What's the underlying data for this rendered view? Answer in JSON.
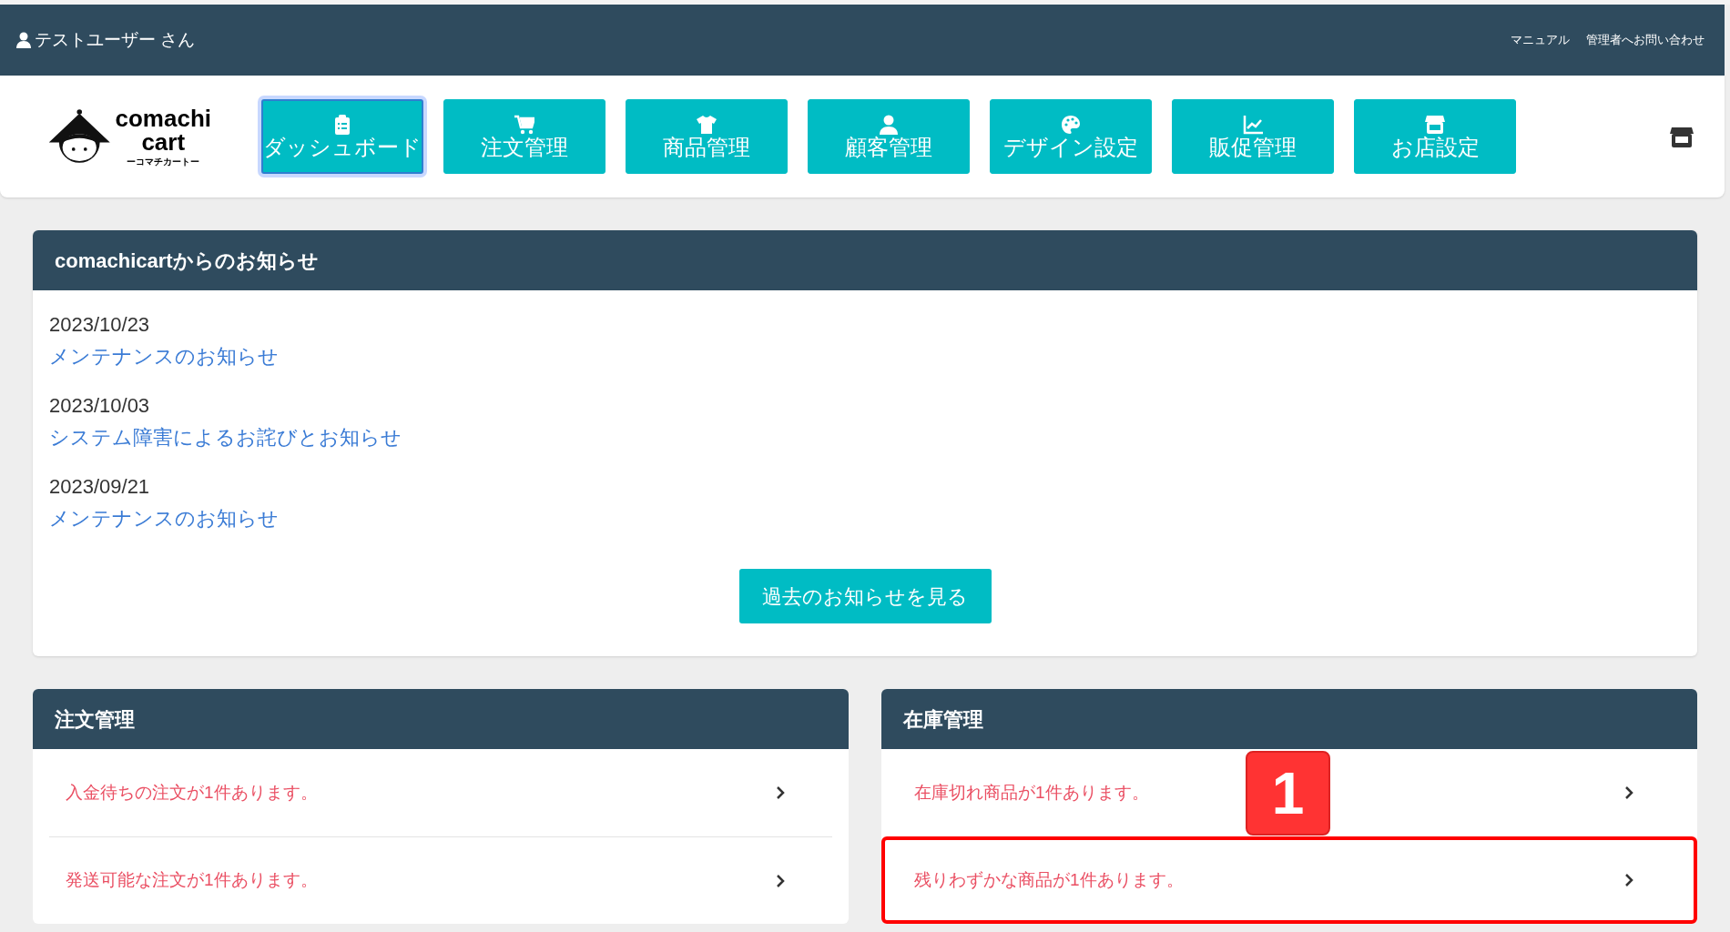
{
  "top_bar": {
    "user": "テストユーザー さん",
    "links": [
      "マニュアル",
      "管理者へお問い合わせ"
    ]
  },
  "logo": {
    "name_line_1": "comachi",
    "name_line_2": "cart",
    "reading": "ーコマチカートー"
  },
  "nav": [
    {
      "label": "ダッシュボード",
      "selected": true
    },
    {
      "label": "注文管理",
      "selected": false
    },
    {
      "label": "商品管理",
      "selected": false
    },
    {
      "label": "顧客管理",
      "selected": false
    },
    {
      "label": "デザイン設定",
      "selected": false
    },
    {
      "label": "販促管理",
      "selected": false
    },
    {
      "label": "お店設定",
      "selected": false
    }
  ],
  "notices": {
    "title": "comachicartからのお知らせ",
    "items": [
      {
        "date": "2023/10/23",
        "title": "メンテナンスのお知らせ"
      },
      {
        "date": "2023/10/03",
        "title": "システム障害によるお詫びとお知らせ"
      },
      {
        "date": "2023/09/21",
        "title": "メンテナンスのお知らせ"
      }
    ],
    "more_button": "過去のお知らせを見る"
  },
  "panels": [
    {
      "title": "注文管理",
      "items": [
        {
          "text": "入金待ちの注文が1件あります。",
          "highlighted": false
        },
        {
          "text": "発送可能な注文が1件あります。",
          "highlighted": false
        }
      ]
    },
    {
      "title": "在庫管理",
      "badge": "1",
      "items": [
        {
          "text": "在庫切れ商品が1件あります。",
          "highlighted": false
        },
        {
          "text": "残りわずかな商品が1件あります。",
          "highlighted": true
        }
      ]
    }
  ]
}
